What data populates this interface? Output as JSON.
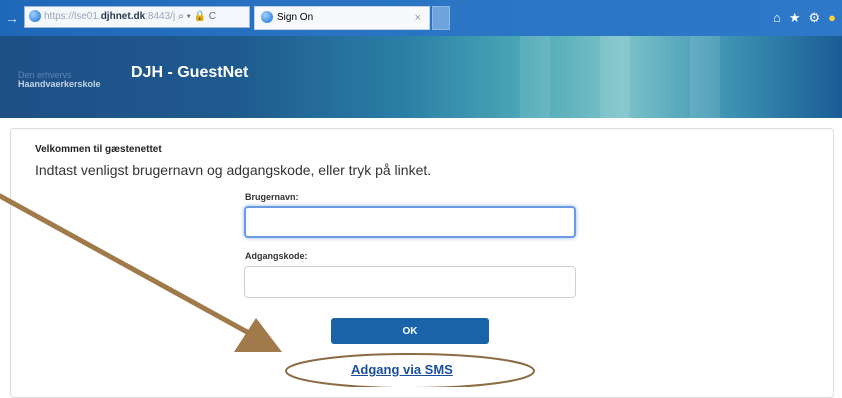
{
  "browser": {
    "address": {
      "prefix": "https://",
      "muted": "lse01.",
      "host": "djhnet.dk",
      "suffix": ":8443/j",
      "tools": "⌕ ▾ 🔒 C"
    },
    "tab": {
      "title": "Sign On",
      "close": "×"
    },
    "icons": [
      "home-icon",
      "favorites-star-icon",
      "settings-gear-icon",
      "feedback-smiley-icon"
    ]
  },
  "banner": {
    "logo_top": "Den erhvervs",
    "logo": "Haandvaerkerskole",
    "title": "DJH - GuestNet"
  },
  "form": {
    "welcome": "Velkommen til gæstenettet",
    "instructions": "Indtast venligst brugernavn og adgangskode, eller tryk på linket.",
    "username_label": "Brugernavn:",
    "username_value": "",
    "password_label": "Adgangskode:",
    "password_value": "",
    "ok_label": "OK",
    "sms_link": "Adgang via SMS"
  },
  "colors": {
    "annotation": "#a07a4a",
    "ok_button": "#1b63a8",
    "link": "#1a4f9c"
  }
}
